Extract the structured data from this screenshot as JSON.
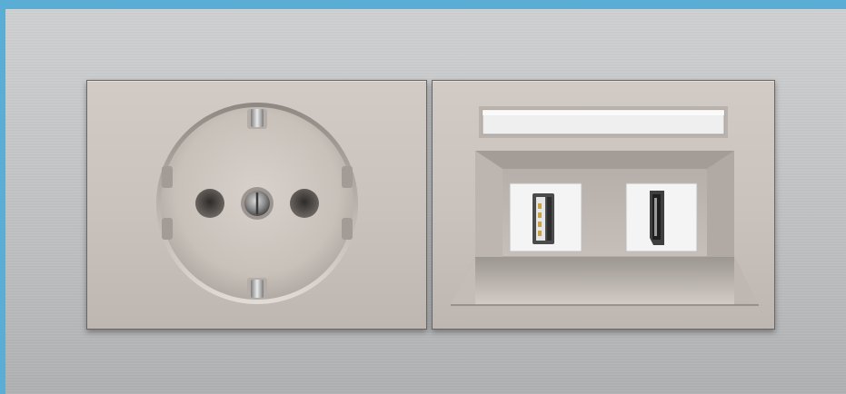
{
  "scene": {
    "left_module": "schuko-socket",
    "right_module": "usb-hdmi-data-outlet",
    "colors": {
      "background": "#5aaed6",
      "wall_plate": "#c4c6c8",
      "module_body": "#cbc4be",
      "label_strip": "#eeeeee",
      "port_insert": "#f2f2f2"
    }
  }
}
